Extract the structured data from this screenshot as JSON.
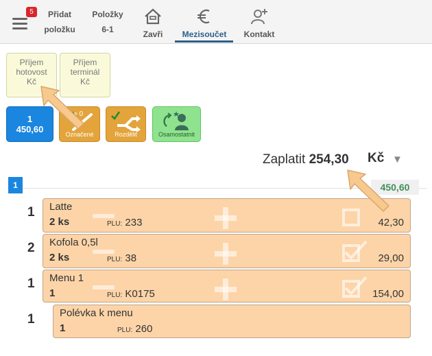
{
  "toolbar": {
    "menu_badge": "5",
    "add_item_line1": "Přidat",
    "add_item_line2": "položku",
    "items_line1": "Položky",
    "items_line2": "6-1",
    "close_label": "Zavři",
    "subtotal_label": "Mezisoučet",
    "contact_label": "Kontakt"
  },
  "payments": [
    {
      "line1": "Příjem",
      "line2": "hotovost",
      "line3": "Kč"
    },
    {
      "line1": "Příjem",
      "line2": "terminál",
      "line3": "Kč"
    }
  ],
  "actions": {
    "seat_num": "1",
    "seat_amount": "450,60",
    "marked_badge": "> 0",
    "marked_label": "Označené",
    "split_label": "Rozdělit",
    "separate_label": "Osamostatnit"
  },
  "totals": {
    "pay_label": "Zaplatit",
    "pay_amount": "254,30",
    "currency": "Kč",
    "seat_badge": "1",
    "seat_total": "450,60"
  },
  "items": [
    {
      "qty": "1",
      "name": "Latte",
      "count": "2 ks",
      "plu_label": "PLU:",
      "plu": "233",
      "price": "42,30"
    },
    {
      "qty": "2",
      "name": "Kofola 0,5l",
      "count": "2 ks",
      "plu_label": "PLU:",
      "plu": "38",
      "price": "29,00"
    },
    {
      "qty": "1",
      "name": "Menu 1",
      "count": "1",
      "plu_label": "PLU:",
      "plu": "K0175",
      "price": "154,00"
    },
    {
      "qty": "1",
      "name": "Polévka k menu",
      "count": "1",
      "plu_label": "PLU:",
      "plu": "260",
      "price": ""
    }
  ],
  "colors": {
    "accent_blue": "#1a86e0",
    "item_bg": "#fcd4a8",
    "action_orange": "#e3a43c",
    "action_green": "#8fe38f",
    "total_green": "#3f8f5a"
  }
}
